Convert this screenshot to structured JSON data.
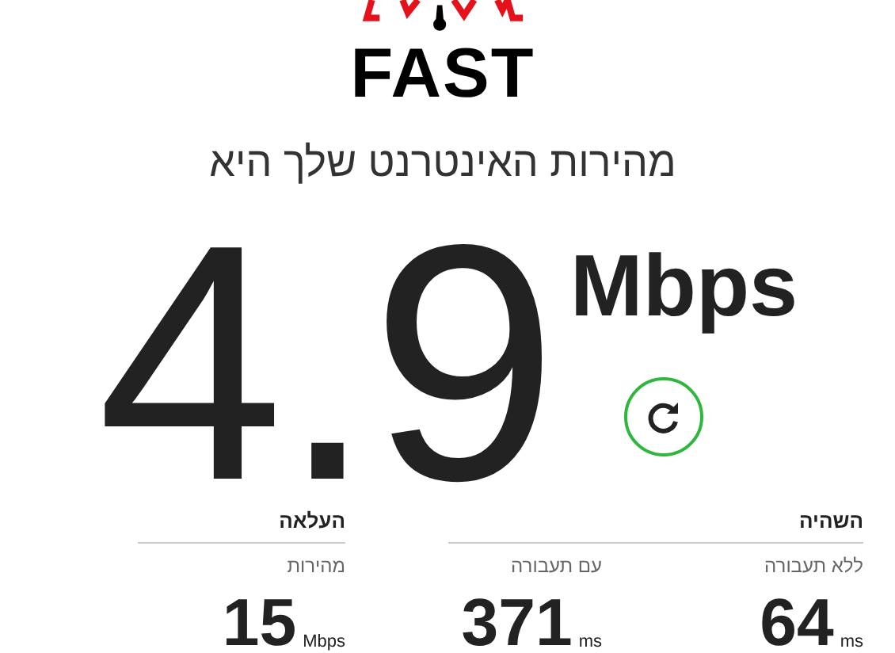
{
  "logo": {
    "wordmark": "FAST"
  },
  "heading": "מהירות האינטרנט שלך היא",
  "speed": {
    "value": "4.9",
    "unit": "Mbps"
  },
  "groups": [
    {
      "title": "השהיה",
      "metrics": [
        {
          "label": "ללא תעבורה",
          "value": "64",
          "unit": "ms"
        },
        {
          "label": "עם תעבורה",
          "value": "371",
          "unit": "ms"
        }
      ]
    },
    {
      "title": "העלאה",
      "metrics": [
        {
          "label": "מהירות",
          "value": "15",
          "unit": "Mbps"
        }
      ]
    }
  ]
}
